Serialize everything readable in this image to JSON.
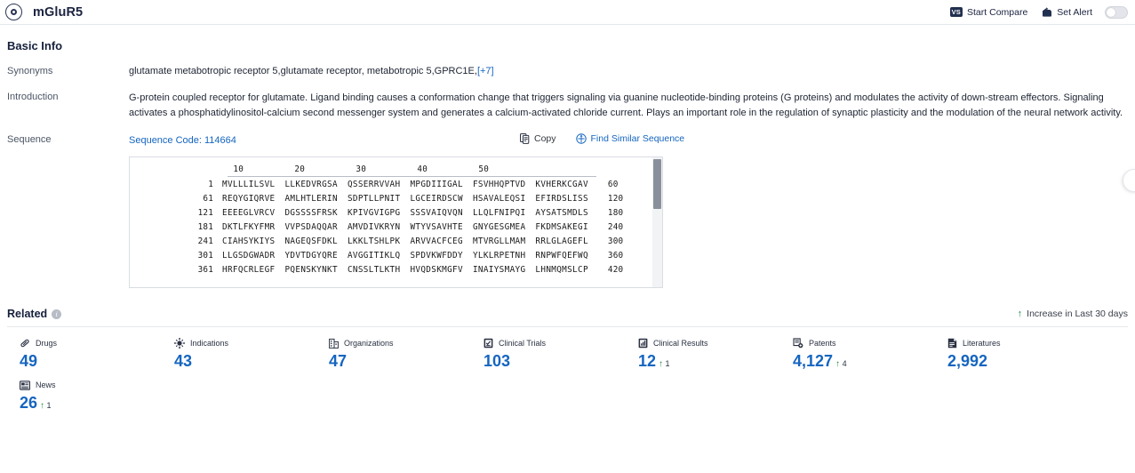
{
  "topbar": {
    "app_title": "mGluR5",
    "logo_icon": "target-logo-icon",
    "compare_label": "Start Compare",
    "compare_badge": "VS",
    "alert_label": "Set Alert",
    "alert_toggle_on": false
  },
  "basic_info": {
    "title": "Basic Info",
    "synonyms": {
      "label": "Synonyms",
      "value": "glutamate metabotropic receptor 5,glutamate receptor, metabotropic 5,GPRC1E,",
      "more_link": "[+7]"
    },
    "introduction": {
      "label": "Introduction",
      "text": "G-protein coupled receptor for glutamate. Ligand binding causes a conformation change that triggers signaling via guanine nucleotide-binding proteins (G proteins) and modulates the activity of down-stream effectors. Signaling activates a phosphatidylinositol-calcium second messenger system and generates a calcium-activated chloride current. Plays an important role in the regulation of synaptic plasticity and the modulation of the neural network activity."
    },
    "sequence": {
      "label": "Sequence",
      "code_label": "Sequence Code: 114664",
      "copy_label": "Copy",
      "copy_icon": "copy-icon",
      "find_similar_label": "Find Similar Sequence",
      "find_similar_icon": "find-similar-icon",
      "ruler": [
        "10",
        "20",
        "30",
        "40",
        "50"
      ],
      "rows": [
        {
          "start": "1",
          "chunks": [
            "MVLLLILSVL",
            "LLKEDVRGSA",
            "QSSERRVVAH",
            "MPGDIIIGAL",
            "FSVHHQPTVD",
            "KVHERKCGAV"
          ],
          "end": "60"
        },
        {
          "start": "61",
          "chunks": [
            "REQYGIQRVE",
            "AMLHTLERIN",
            "SDPTLLPNIT",
            "LGCEIRDSCW",
            "HSAVALEQSI",
            "EFIRDSLISS"
          ],
          "end": "120"
        },
        {
          "start": "121",
          "chunks": [
            "EEEEGLVRCV",
            "DGSSSSFRSK",
            "KPIVGVIGPG",
            "SSSVAIQVQN",
            "LLQLFNIPQI",
            "AYSATSMDLS"
          ],
          "end": "180"
        },
        {
          "start": "181",
          "chunks": [
            "DKTLFKYFMR",
            "VVPSDAQQAR",
            "AMVDIVKRYN",
            "WTYVSAVHTE",
            "GNYGESGMEA",
            "FKDMSAKEGI"
          ],
          "end": "240"
        },
        {
          "start": "241",
          "chunks": [
            "CIAHSYKIYS",
            "NAGEQSFDKL",
            "LKKLTSHLPK",
            "ARVVACFCEG",
            "MTVRGLLMAM",
            "RRLGLAGEFL"
          ],
          "end": "300"
        },
        {
          "start": "301",
          "chunks": [
            "LLGSDGWADR",
            "YDVTDGYQRE",
            "AVGGITIKLQ",
            "SPDVKWFDDY",
            "YLKLRPETNH",
            "RNPWFQEFWQ"
          ],
          "end": "360"
        },
        {
          "start": "361",
          "chunks": [
            "HRFQCRLEGF",
            "PQENSKYNKT",
            "CNSSLTLKTH",
            "HVQDSKMGFV",
            "INAIYSMAYG",
            "LHNMQMSLCP"
          ],
          "end": "420"
        }
      ]
    }
  },
  "related": {
    "title": "Related",
    "info_icon": "info-icon",
    "increase_note": "Increase in Last 30 days",
    "increase_icon": "arrow-up-icon",
    "stats": [
      {
        "label": "Drugs",
        "icon": "pill-icon",
        "value": "49",
        "delta": ""
      },
      {
        "label": "Indications",
        "icon": "virus-icon",
        "value": "43",
        "delta": ""
      },
      {
        "label": "Organizations",
        "icon": "building-icon",
        "value": "47",
        "delta": ""
      },
      {
        "label": "Clinical Trials",
        "icon": "clinical-trial-icon",
        "value": "103",
        "delta": ""
      },
      {
        "label": "Clinical Results",
        "icon": "clinical-result-icon",
        "value": "12",
        "delta": "1"
      },
      {
        "label": "Patents",
        "icon": "patent-icon",
        "value": "4,127",
        "delta": "4"
      },
      {
        "label": "Literatures",
        "icon": "literature-icon",
        "value": "2,992",
        "delta": ""
      },
      {
        "label": "News",
        "icon": "news-icon",
        "value": "26",
        "delta": "1"
      }
    ]
  },
  "float_button": {
    "icon": "side-panel-toggle-icon"
  }
}
